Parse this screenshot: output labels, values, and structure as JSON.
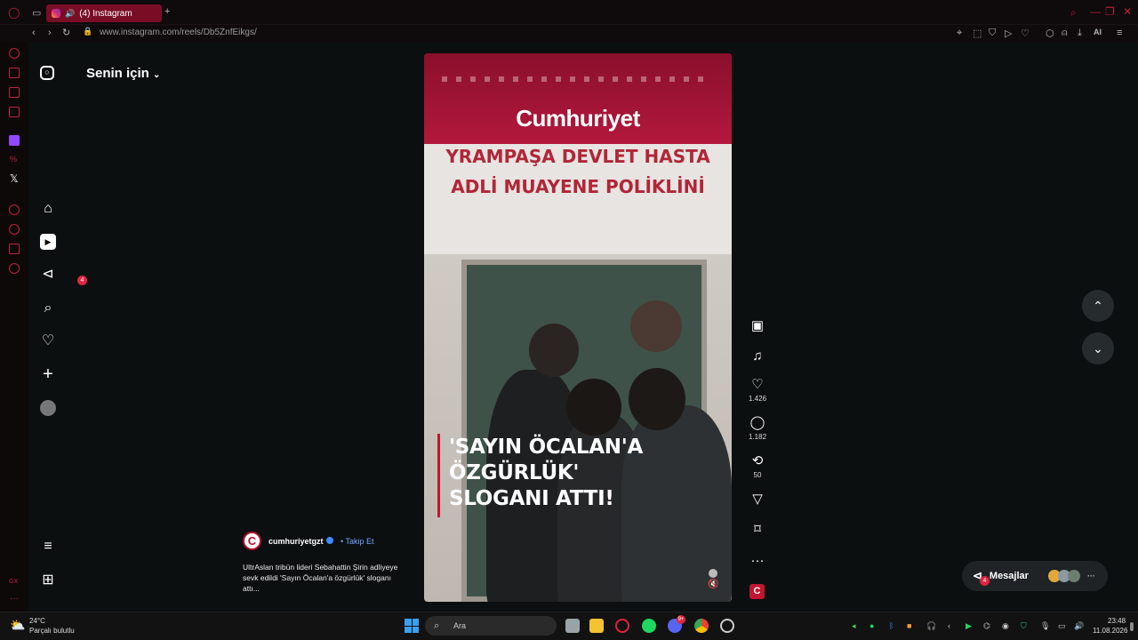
{
  "browser": {
    "tab_title": "(4) Instagram",
    "new_tab": "+",
    "url": "www.instagram.com/reels/Db5ZnfEikgs/",
    "ai_label": "AI"
  },
  "instagram": {
    "feed_title": "Senin için",
    "notifications_badge": "4",
    "reel": {
      "banner_logo": "Cumhuriyet",
      "sign_line1": "YRAMPAŞA DEVLET HASTA",
      "sign_line2": "ADLİ MUAYENE POLİKLİNİ",
      "overlay_line1": "'SAYIN ÖCALAN'A",
      "overlay_line2": "ÖZGÜRLÜK'",
      "overlay_line3": "SLOGANI ATTI!"
    },
    "actions": {
      "likes": "1.426",
      "comments": "1.182",
      "reposts": "50"
    },
    "caption": {
      "avatar_letter": "C",
      "username": "cumhuriyetgzt",
      "follow": "• Takip Et",
      "text": "UltrAslan tribün lideri Sebahattin Şirin adliyeye sevk edildi 'Sayın Öcalan'a özgürlük' sloganı attı..."
    },
    "messages": {
      "label": "Mesajlar",
      "badge": "4"
    }
  },
  "taskbar": {
    "weather_temp": "24°C",
    "weather_desc": "Parçalı bulutlu",
    "search_placeholder": "Ara",
    "time": "23:48",
    "date": "11.08.2026",
    "discord_badge": "9+"
  },
  "colors": {
    "accent": "#c41f3b",
    "brand_red": "#b3183c",
    "link": "#6ea8ff"
  }
}
